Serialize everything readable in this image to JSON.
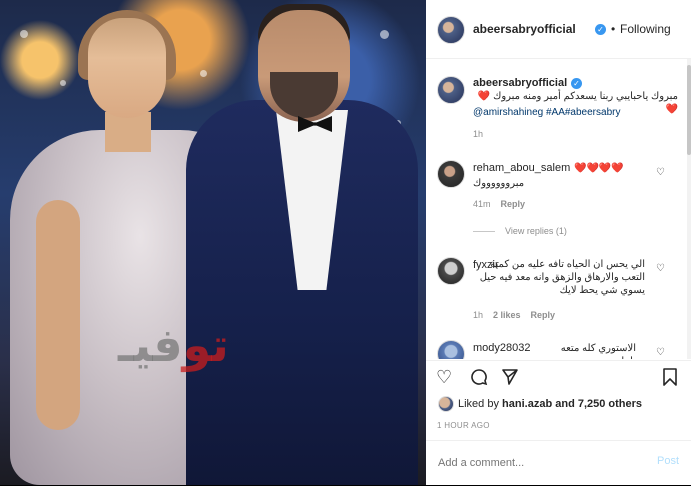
{
  "header": {
    "username": "abeersabryofficial",
    "follow_separator": "•",
    "following_label": "Following"
  },
  "comments": [
    {
      "username": "abeersabryofficial",
      "text": "مبروك ياحبايبي ربنا يسعدكم أمير ومنه مبروك ❤️❤️",
      "mention": "@amirshahineg #AA#abeersabry",
      "time": "1h"
    },
    {
      "username": "reham_abou_salem",
      "text_line1": "❤️❤️❤️❤️",
      "text_line2": "مبرووووووك",
      "time": "41m",
      "reply_label": "Reply",
      "view_replies": "View replies (1)"
    },
    {
      "username": "fyxzir",
      "text": "الي يحس ان الحياه تافه عليه من كمية التعب والارهاق والزهق وانه معد فيه حيل يسوي شي يحط لايك",
      "time": "1h",
      "likes": "2 likes",
      "reply_label": "Reply"
    },
    {
      "username": "mody28032",
      "text": "الاستوري كله متعه يابنات"
    }
  ],
  "actions": {
    "liked_prefix": "Liked by",
    "liked_user": "hani.azab",
    "liked_suffix": "and 7,250 others",
    "time_ago": "1 HOUR AGO"
  },
  "add_comment": {
    "placeholder": "Add a comment...",
    "post_label": "Post"
  },
  "photo": {
    "watermark_gray": "فيـ",
    "watermark_red": "تو"
  },
  "colors": {
    "verified": "#3897f0",
    "link": "#00376b",
    "muted": "#8e8e8e",
    "post_disabled": "#b2dffc"
  }
}
